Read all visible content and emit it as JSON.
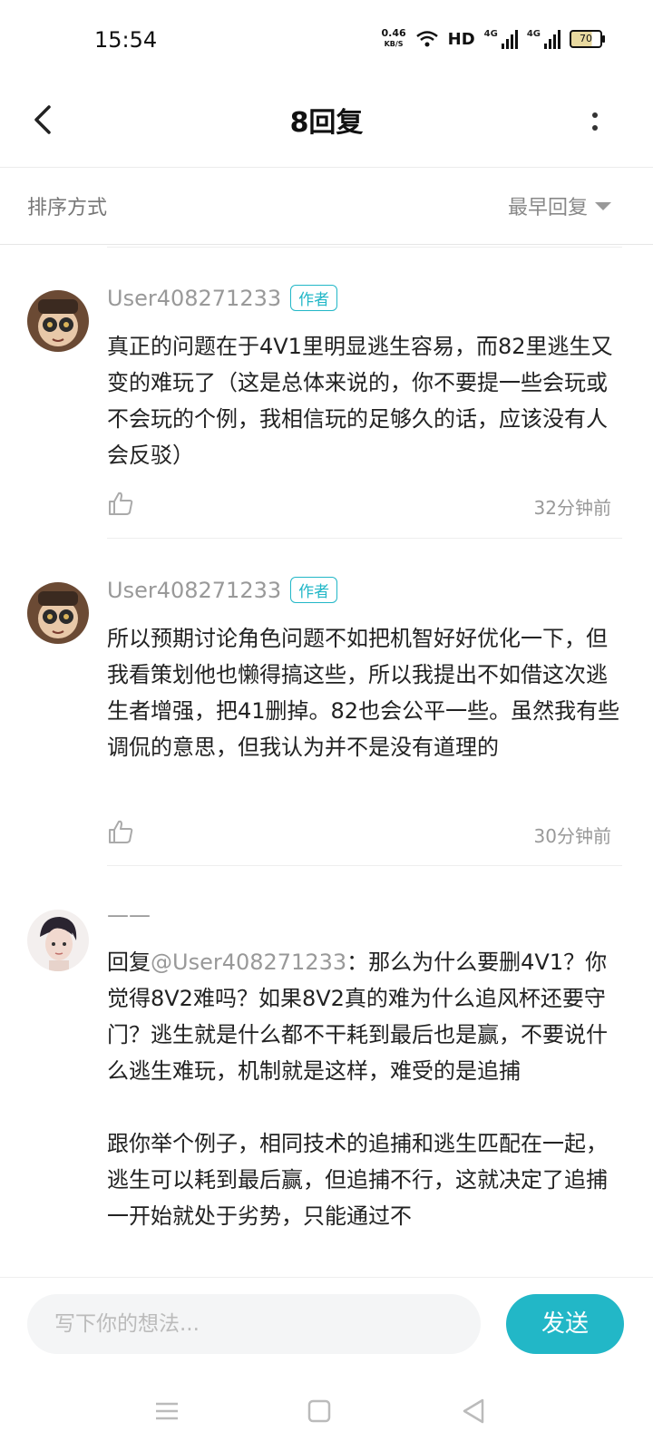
{
  "status_bar": {
    "time": "15:54",
    "net_speed_value": "0.46",
    "net_speed_unit": "KB/S",
    "hd_label": "HD",
    "signal_1": "4G",
    "signal_2": "4G",
    "battery": "70"
  },
  "header": {
    "title": "8回复"
  },
  "sort": {
    "label": "排序方式",
    "selected": "最早回复"
  },
  "comments": [
    {
      "user": "User408271233",
      "badge": "作者",
      "text": "真正的问题在于4V1里明显逃生容易，而82里逃生又变的难玩了（这是总体来说的，你不要提一些会玩或不会玩的个例，我相信玩的足够久的话，应该没有人会反驳）",
      "time": "32分钟前"
    },
    {
      "user": "User408271233",
      "badge": "作者",
      "text": "所以预期讨论角色问题不如把机智好好优化一下，但我看策划他也懒得搞这些，所以我提出不如借这次逃生者增强，把41删掉。82也会公平一些。虽然我有些调侃的意思，但我认为并不是没有道理的",
      "time": "30分钟前"
    },
    {
      "user": "——",
      "reply_prefix": "回复",
      "reply_to": "@User408271233",
      "text": "：那么为什么要删4V1？你觉得8V2难吗？如果8V2真的难为什么追风杯还要守门？逃生就是什么都不干耗到最后也是赢，不要说什么逃生难玩，机制就是这样，难受的是追捕\n\n跟你举个例子，相同技术的追捕和逃生匹配在一起，逃生可以耗到最后赢，但追捕不行，这就决定了追捕一开始就处于劣势，只能通过不"
    }
  ],
  "composer": {
    "placeholder": "写下你的想法...",
    "send_label": "发送"
  },
  "icons": {
    "back": "chevron-left-icon",
    "more": "more-vertical-icon",
    "sort_caret": "caret-down-icon",
    "like": "thumbs-up-icon",
    "nav_menu": "menu-icon",
    "nav_home": "square-icon",
    "nav_back": "triangle-back-icon"
  },
  "colors": {
    "accent": "#22b7c7",
    "muted_text": "#999999"
  }
}
